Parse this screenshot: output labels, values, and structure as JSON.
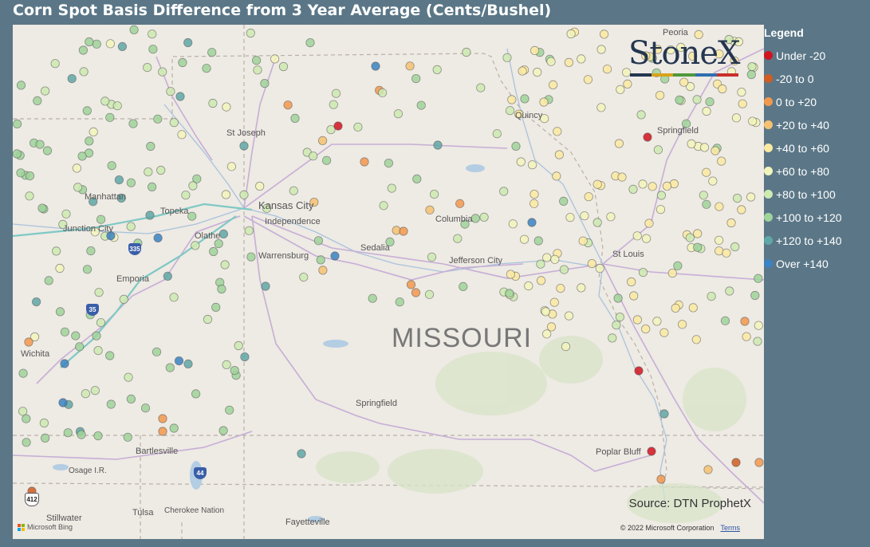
{
  "title": "Corn Spot Basis Difference from 3 Year Average (Cents/Bushel)",
  "legend": {
    "title": "Legend",
    "items": [
      {
        "label": "Under -20",
        "color": "#d1131f"
      },
      {
        "label": "-20 to 0",
        "color": "#cf5d22"
      },
      {
        "label": "0 to +20",
        "color": "#f2984d"
      },
      {
        "label": "+20 to +40",
        "color": "#f5c271"
      },
      {
        "label": "+40 to +60",
        "color": "#faeaa2"
      },
      {
        "label": "+60 to +80",
        "color": "#f2f5bb"
      },
      {
        "label": "+80 to +100",
        "color": "#cdeab0"
      },
      {
        "label": "+100 to +120",
        "color": "#9fd49a"
      },
      {
        "label": "+120 to +140",
        "color": "#5fa7a6"
      },
      {
        "label": "Over +140",
        "color": "#3a82c2"
      }
    ]
  },
  "map": {
    "region_label": "MISSOURI",
    "cities": [
      "St Joseph",
      "Manhattan",
      "Topeka",
      "Junction City",
      "Kansas City",
      "Independence",
      "Olathe",
      "Emporia",
      "Warrensburg",
      "Sedalia",
      "Columbia",
      "Jefferson City",
      "St Louis",
      "Springfield",
      "Springfield",
      "Wichita",
      "Bartlesville",
      "Osage I.R.",
      "Tulsa",
      "Cherokee Nation",
      "Stillwater",
      "Fayetteville",
      "Poplar Bluff",
      "Quincy",
      "Peoria"
    ],
    "highway_shields": [
      "335",
      "35",
      "44",
      "412"
    ]
  },
  "logo": {
    "text": "StoneX",
    "bar_colors": [
      "#24364f",
      "#d8a21c",
      "#4f9a3b",
      "#2f6fb0",
      "#c9302c"
    ]
  },
  "source": "Source: DTN ProphetX",
  "copyright": "© 2022 Microsoft Corporation",
  "terms": "Terms",
  "attribution": "Microsoft Bing"
}
